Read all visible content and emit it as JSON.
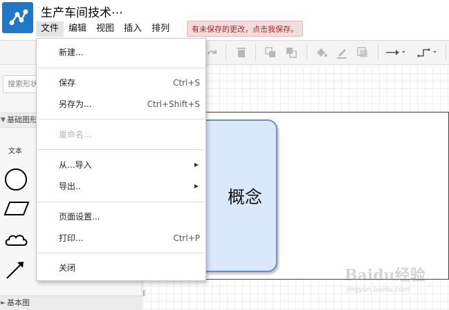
{
  "app": {
    "title": "生产车间技术⋯",
    "save_notice": "有未保存的更改，点击我保存。",
    "logo_color": "#1f78c6"
  },
  "menubar": {
    "items": [
      "文件",
      "编辑",
      "视图",
      "插入",
      "排列"
    ],
    "active": "文件"
  },
  "toolbar": {
    "icons": [
      "redo-icon",
      "delete-icon",
      "to-front-icon",
      "to-back-icon",
      "fill-color-icon",
      "line-color-icon",
      "shadow-icon",
      "connection-arrow-icon",
      "waypoint-icon"
    ]
  },
  "sidebar": {
    "search_placeholder": "搜索形状",
    "palette_general": "基础图形",
    "shape_text_label": "文本",
    "palette_bottom": "基本图"
  },
  "canvas": {
    "concept_label": "概念",
    "concept_fill": "#dae8fc",
    "concept_stroke": "#6c8ebf"
  },
  "file_menu": {
    "new": "新建...",
    "save": "保存",
    "save_shortcut": "Ctrl+S",
    "save_as": "另存为...",
    "save_as_shortcut": "Ctrl+Shift+S",
    "rename": "重命名...",
    "import_from": "从...导入",
    "export": "导出..",
    "page_setup": "页面设置...",
    "print": "打印...",
    "print_shortcut": "Ctrl+P",
    "close": "关闭"
  },
  "watermark": {
    "main": "Baidu经验",
    "sub": "jingyan.baidu.com"
  }
}
